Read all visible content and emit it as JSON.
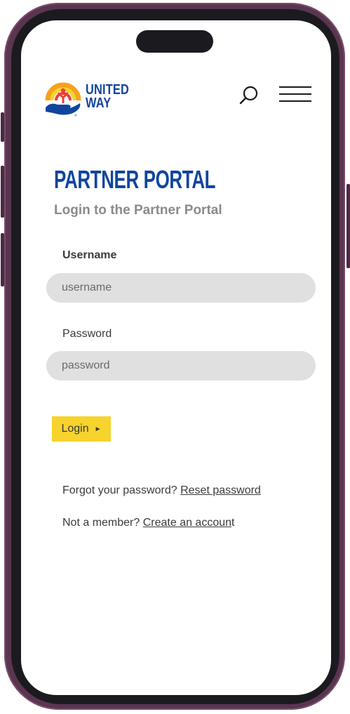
{
  "header": {
    "logo_line1": "UNITED",
    "logo_line2": "WAY",
    "search_icon": "search-icon",
    "menu_icon": "hamburger-menu-icon"
  },
  "main": {
    "title": "PARTNER PORTAL",
    "subtitle": "Login to the Partner Portal",
    "username_label": "Username",
    "username_placeholder": "username",
    "password_label": "Password",
    "password_placeholder": "password",
    "login_label": "Login",
    "login_arrow": "►",
    "forgot_text": "Forgot your password?",
    "reset_link": "Reset password",
    "member_text": "Not a member?",
    "create_link": "Create an accoun",
    "create_suffix": "t"
  },
  "colors": {
    "brand_blue": "#10459e",
    "button_yellow": "#f6d32d",
    "input_gray": "#e0e0e0",
    "frame_purple": "#5a3550"
  }
}
